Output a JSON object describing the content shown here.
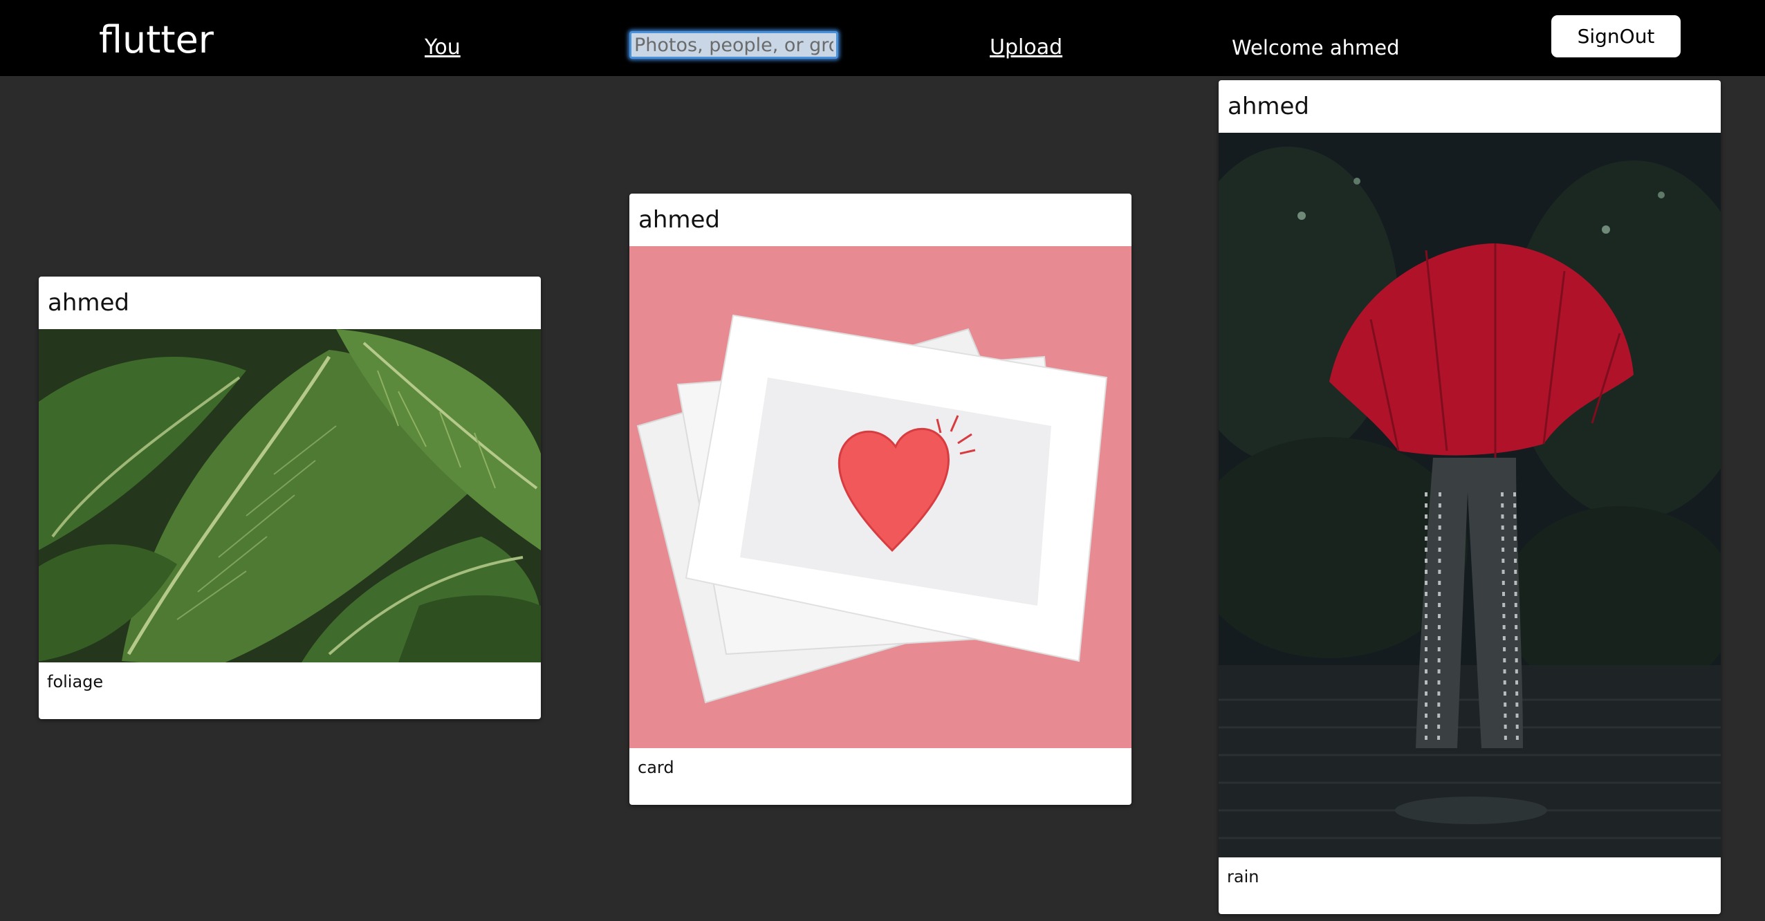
{
  "navbar": {
    "brand": "flutter",
    "you_label": "You",
    "search_placeholder": "Photos, people, or groups",
    "upload_label": "Upload",
    "welcome_text": "Welcome ahmed",
    "signout_label": "SignOut"
  },
  "feed": [
    {
      "user": "ahmed",
      "caption": "foliage",
      "image_subject": "green leaves"
    },
    {
      "user": "ahmed",
      "caption": "card",
      "image_subject": "envelopes with red heart on pink background"
    },
    {
      "user": "ahmed",
      "caption": "rain",
      "image_subject": "person with red umbrella in rain"
    }
  ],
  "colors": {
    "navbar_bg": "#000000",
    "page_bg": "#2b2b2b",
    "card_bg": "#ffffff",
    "heart_red": "#f0585a",
    "umbrella_red": "#b0122a",
    "pink_bg": "#e88a91",
    "leaf_green": "#4f7a34"
  }
}
